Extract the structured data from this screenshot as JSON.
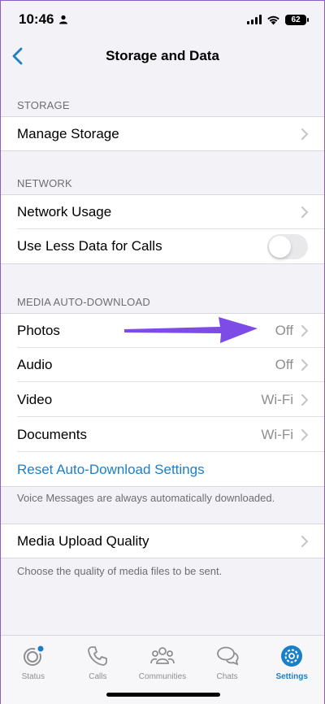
{
  "status_bar": {
    "time": "10:46",
    "battery": "62"
  },
  "nav": {
    "title": "Storage and Data"
  },
  "sections": {
    "storage": {
      "header": "STORAGE",
      "manage_storage": "Manage Storage"
    },
    "network": {
      "header": "NETWORK",
      "network_usage": "Network Usage",
      "use_less_data": "Use Less Data for Calls",
      "use_less_data_on": false
    },
    "media": {
      "header": "MEDIA AUTO-DOWNLOAD",
      "rows": [
        {
          "label": "Photos",
          "value": "Off"
        },
        {
          "label": "Audio",
          "value": "Off"
        },
        {
          "label": "Video",
          "value": "Wi-Fi"
        },
        {
          "label": "Documents",
          "value": "Wi-Fi"
        }
      ],
      "reset": "Reset Auto-Download Settings",
      "footnote": "Voice Messages are always automatically downloaded."
    },
    "upload": {
      "label": "Media Upload Quality",
      "footnote": "Choose the quality of media files to be sent."
    }
  },
  "tabs": [
    {
      "label": "Status",
      "icon": "status-icon"
    },
    {
      "label": "Calls",
      "icon": "phone-icon"
    },
    {
      "label": "Communities",
      "icon": "communities-icon"
    },
    {
      "label": "Chats",
      "icon": "chats-icon"
    },
    {
      "label": "Settings",
      "icon": "gear-icon",
      "active": true
    }
  ],
  "colors": {
    "accent": "#1b7fc7",
    "arrow": "#7d4ce6"
  }
}
